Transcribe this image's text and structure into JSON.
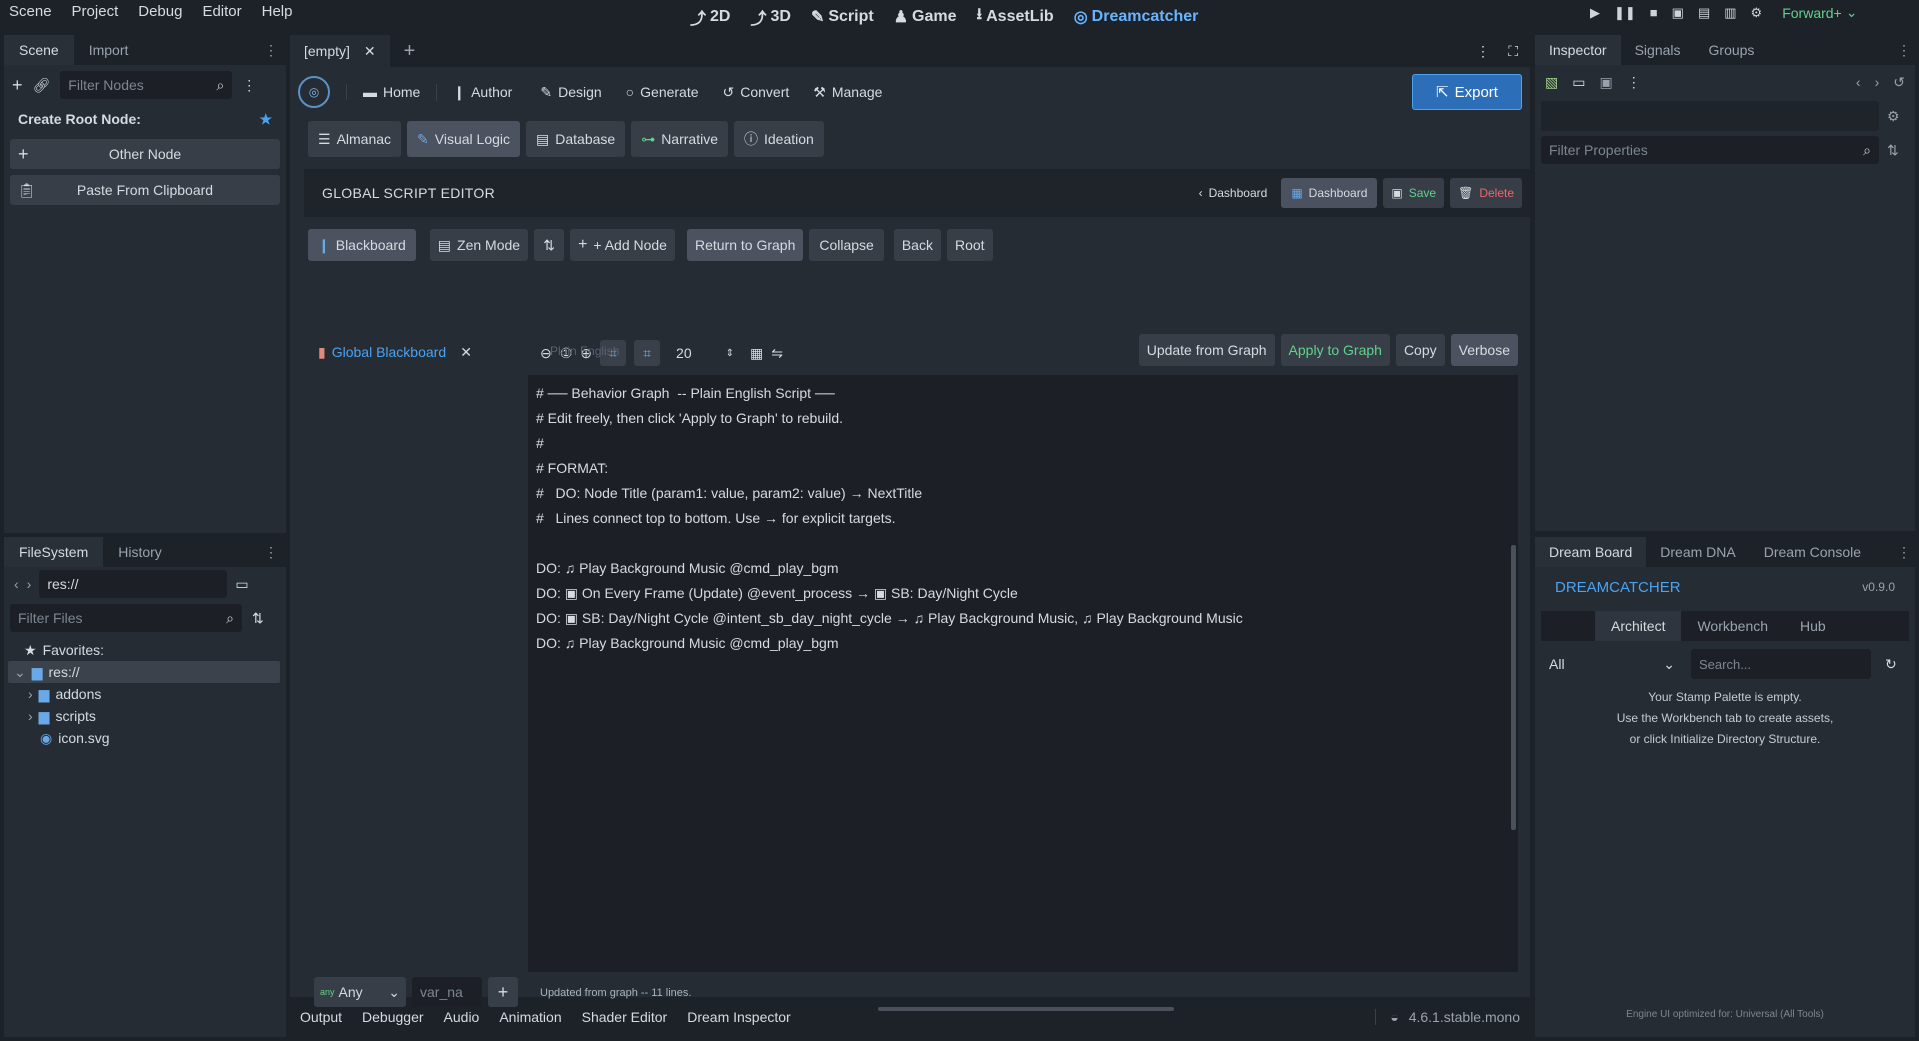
{
  "menu": {
    "items": [
      "Scene",
      "Project",
      "Debug",
      "Editor",
      "Help"
    ],
    "workspaces": [
      "2D",
      "3D",
      "Script",
      "Game",
      "AssetLib",
      "Dreamcatcher"
    ],
    "renderer": "Forward+"
  },
  "scene_dock": {
    "tabs": [
      "Scene",
      "Import"
    ],
    "filter_placeholder": "Filter Nodes",
    "create_root_label": "Create Root Node:",
    "other_node": "Other Node",
    "paste_clipboard": "Paste From Clipboard"
  },
  "filesystem_dock": {
    "tabs": [
      "FileSystem",
      "History"
    ],
    "path": "res://",
    "filter_placeholder": "Filter Files",
    "favorites": "Favorites:",
    "tree": [
      "res://",
      "addons",
      "scripts",
      "icon.svg"
    ]
  },
  "editor_tabs": {
    "active": "[empty]"
  },
  "plugin": {
    "nav": [
      "Home",
      "Author",
      "Design",
      "Generate",
      "Convert",
      "Manage"
    ],
    "export": "Export",
    "subnav": [
      "Almanac",
      "Visual Logic",
      "Database",
      "Narrative",
      "Ideation"
    ],
    "section_title": "GLOBAL SCRIPT EDITOR",
    "header_buttons": {
      "back_dashboard": "Dashboard",
      "dashboard": "Dashboard",
      "save": "Save",
      "delete": "Delete"
    },
    "toolbar": [
      "Blackboard",
      "Zen Mode",
      "+ Add Node",
      "Return to Graph",
      "Collapse",
      "Back",
      "Root"
    ],
    "blackboard_title": "Global Blackboard",
    "zoom_value": "20",
    "script_buttons": {
      "update": "Update from Graph",
      "apply": "Apply to Graph",
      "copy": "Copy",
      "verbose": "Verbose"
    },
    "script_lines": [
      "# ── Behavior Graph  -- Plain English Script ──",
      "# Edit freely, then click 'Apply to Graph' to rebuild.",
      "#",
      "# FORMAT:",
      "#   DO: Node Title (param1: value, param2: value) → NextTitle",
      "#   Lines connect top to bottom. Use → for explicit targets.",
      "",
      "DO: ♫ Play Background Music @cmd_play_bgm",
      "DO: ▣ On Every Frame (Update) @event_process → ▣ SB: Day/Night Cycle",
      "DO: ▣ SB: Day/Night Cycle @intent_sb_day_night_cycle → ♫ Play Background Music, ♫ Play Background Music",
      "DO: ♫ Play Background Music @cmd_play_bgm"
    ],
    "status": "Updated from graph -- 11 lines.",
    "var_type": "Any",
    "var_placeholder": "var_na",
    "overlay_text": "Plain English"
  },
  "bottom_panel": {
    "tabs": [
      "Output",
      "Debugger",
      "Audio",
      "Animation",
      "Shader Editor",
      "Dream Inspector"
    ],
    "version": "4.6.1.stable.mono"
  },
  "inspector": {
    "tabs": [
      "Inspector",
      "Signals",
      "Groups"
    ],
    "filter_placeholder": "Filter Properties"
  },
  "dream": {
    "tabs": [
      "Dream Board",
      "Dream DNA",
      "Dream Console"
    ],
    "title": "DREAMCATCHER",
    "version": "v0.9.0",
    "subtabs": [
      "Architect",
      "Workbench",
      "Hub"
    ],
    "filter": "All",
    "search_placeholder": "Search...",
    "empty_lines": [
      "Your Stamp Palette is empty.",
      "Use the Workbench tab to create assets,",
      "or click Initialize Directory Structure."
    ],
    "footer": "Engine UI optimized for: Universal (All Tools)"
  },
  "colors": {
    "accent": "#4aa3f0",
    "green": "#5fd38a",
    "red": "#f0656c",
    "bg": "#1d2229",
    "panel": "#262c34"
  }
}
